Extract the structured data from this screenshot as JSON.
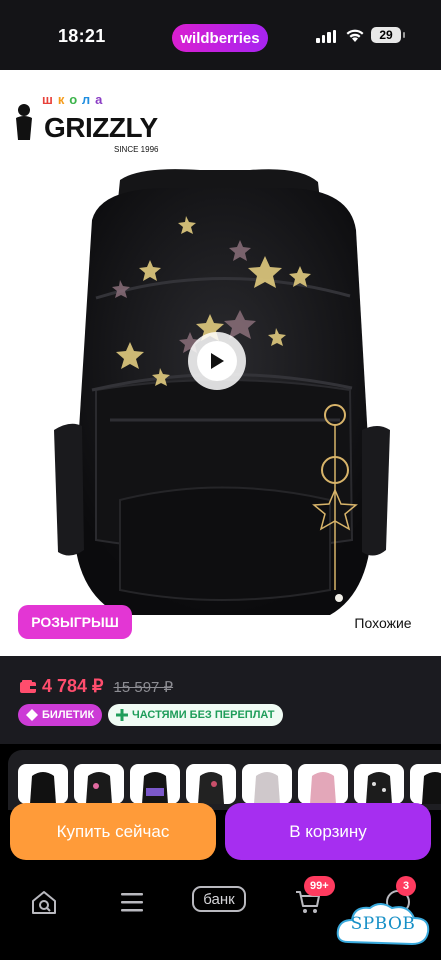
{
  "status_bar": {
    "time": "18:21",
    "brand": "wildberries",
    "battery": "29"
  },
  "product": {
    "logo": {
      "school_word": [
        "ш",
        "к",
        "о",
        "л",
        "а"
      ],
      "brand": "GRIZZLY",
      "since": "SINCE 1996"
    },
    "icons": [
      "heart-icon",
      "share-icon",
      "play-icon"
    ],
    "lottery_badge": "РОЗЫГРЫШ",
    "similar_label": "Похожие"
  },
  "price": {
    "current": "4 784 ₽",
    "old": "15 597 ₽",
    "chips": {
      "ticket": "БИЛЕТИК",
      "installments": "ЧАСТЯМИ БЕЗ ПЕРЕПЛАТ"
    }
  },
  "actions": {
    "buy_now": "Купить сейчас",
    "to_cart": "В корзину"
  },
  "bottom_nav": {
    "bank": "банк",
    "cart_badge": "99+",
    "profile_badge": "3",
    "icons": [
      "home-search-icon",
      "catalog-icon",
      "cart-icon",
      "profile-icon"
    ]
  },
  "watermark": "SPBOB",
  "colors": {
    "brand_gradient_start": "#d91fd0",
    "brand_gradient_end": "#a724f1",
    "price_red": "#ff4d6d",
    "buy_now_orange": "#ff9b39",
    "cart_purple": "#a62ef0",
    "lottery_pink": "#e336d4"
  }
}
